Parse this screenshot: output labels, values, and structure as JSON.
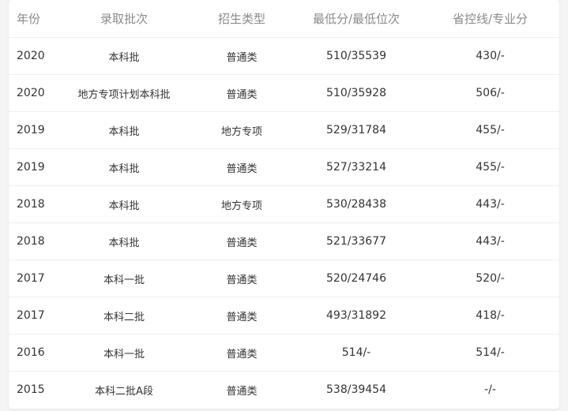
{
  "headers": {
    "year": "年份",
    "batch": "录取批次",
    "type": "招生类型",
    "score": "最低分/最低位次",
    "line": "省控线/专业分"
  },
  "rows": [
    {
      "year": "2020",
      "batch": "本科批",
      "type": "普通类",
      "score": "510/35539",
      "line": "430/-"
    },
    {
      "year": "2020",
      "batch": "地方专项计划本科批",
      "type": "普通类",
      "score": "510/35928",
      "line": "506/-"
    },
    {
      "year": "2019",
      "batch": "本科批",
      "type": "地方专项",
      "score": "529/31784",
      "line": "455/-"
    },
    {
      "year": "2019",
      "batch": "本科批",
      "type": "普通类",
      "score": "527/33214",
      "line": "455/-"
    },
    {
      "year": "2018",
      "batch": "本科批",
      "type": "地方专项",
      "score": "530/28438",
      "line": "443/-"
    },
    {
      "year": "2018",
      "batch": "本科批",
      "type": "普通类",
      "score": "521/33677",
      "line": "443/-"
    },
    {
      "year": "2017",
      "batch": "本科一批",
      "type": "普通类",
      "score": "520/24746",
      "line": "520/-"
    },
    {
      "year": "2017",
      "batch": "本科二批",
      "type": "普通类",
      "score": "493/31892",
      "line": "418/-"
    },
    {
      "year": "2016",
      "batch": "本科一批",
      "type": "普通类",
      "score": "514/-",
      "line": "514/-"
    },
    {
      "year": "2015",
      "batch": "本科二批A段",
      "type": "普通类",
      "score": "538/39454",
      "line": "-/-"
    }
  ]
}
